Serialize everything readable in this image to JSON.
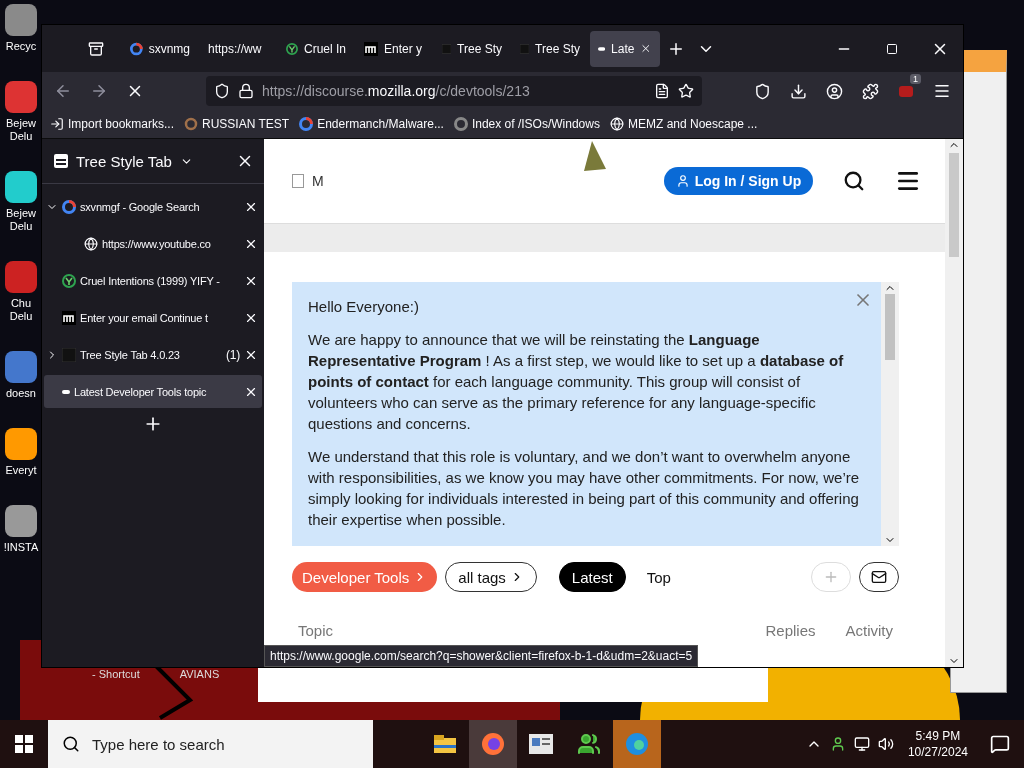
{
  "desktop": {
    "icons": [
      {
        "label": "Recyc"
      },
      {
        "label": "Bejew Delu"
      },
      {
        "label": "Bejew Delu"
      },
      {
        "label": "Chu Delu"
      },
      {
        "label": "doesn"
      },
      {
        "label": "Everyt"
      },
      {
        "label": "!INSTA"
      }
    ],
    "labels": [
      "- Shortcut",
      "AVIANS"
    ]
  },
  "browser": {
    "tabs": [
      {
        "title": "sxvnmg",
        "kind": "google",
        "selected": false
      },
      {
        "title": "https://ww",
        "kind": "blank",
        "selected": false
      },
      {
        "title": "Cruel In",
        "kind": "yify",
        "selected": false
      },
      {
        "title": "Enter y",
        "kind": "mono",
        "selected": false
      },
      {
        "title": "Tree Sty",
        "kind": "tst",
        "selected": false
      },
      {
        "title": "Tree Sty",
        "kind": "tst",
        "selected": false
      },
      {
        "title": "Late",
        "kind": "dot",
        "selected": true
      }
    ],
    "url": {
      "prefix": "https://discourse.",
      "domain": "mozilla.org",
      "path": "/c/devtools/213"
    },
    "extension_badge": "1",
    "bookmarks": [
      {
        "label": "Import bookmarks...",
        "kind": "import"
      },
      {
        "label": "RUSSIAN TEST",
        "kind": "ring"
      },
      {
        "label": "Endermanch/Malware...",
        "kind": "google"
      },
      {
        "label": "Index of /ISOs/Windows",
        "kind": "ringdim"
      },
      {
        "label": "MEMZ and Noescape ...",
        "kind": "globe"
      }
    ],
    "sidebar": {
      "title": "Tree Style Tab",
      "tabs": [
        {
          "title": "sxvnmgf - Google Search",
          "kind": "google",
          "selected": false,
          "expanded": true,
          "children": [
            {
              "title": "https://www.youtube.co",
              "kind": "globe",
              "selected": false
            }
          ]
        },
        {
          "title": "Cruel Intentions (1999) YIFY -",
          "kind": "yify",
          "selected": false
        },
        {
          "title": "Enter your email Continue t",
          "kind": "mono",
          "selected": false
        },
        {
          "title": "Tree Style Tab 4.0.23",
          "kind": "tst",
          "selected": false,
          "expanded": false,
          "count": "(1)"
        },
        {
          "title": "Latest Developer Tools topic",
          "kind": "dot",
          "selected": true
        }
      ]
    },
    "page": {
      "logo_text": "M",
      "login": "Log In / Sign Up",
      "banner": {
        "greeting": "Hello Everyone:)",
        "paragraphs": [
          "We are happy to announce that we will be reinstating the **Language Representative Program** ! As a first step, we would like to set up a **database of points of contact** for each language community. This group will consist of volunteers who can serve as the primary reference for any language-specific questions and concerns.",
          "We understand that this role is voluntary, and we don’t want to overwhelm anyone with responsibilities, as we know you may have other commitments. For now, we’re simply looking for individuals interested in being part of this community and offering their expertise when possible."
        ]
      },
      "category": "Developer Tools",
      "tags": "all tags",
      "filters": [
        {
          "label": "Latest",
          "selected": true
        },
        {
          "label": "Top",
          "selected": false
        }
      ],
      "columns": [
        "Topic",
        "Replies",
        "Activity"
      ]
    },
    "status_link": "https://www.google.com/search?q=shower&client=firefox-b-1-d&udm=2&uact=5"
  },
  "taskbar": {
    "search_placeholder": "Type here to search",
    "apps": [
      {
        "kind": "folder"
      },
      {
        "kind": "firefox"
      },
      {
        "kind": "news"
      },
      {
        "kind": "messenger"
      },
      {
        "kind": "edge"
      }
    ],
    "time": "5:49 PM",
    "date": "10/27/2024"
  }
}
